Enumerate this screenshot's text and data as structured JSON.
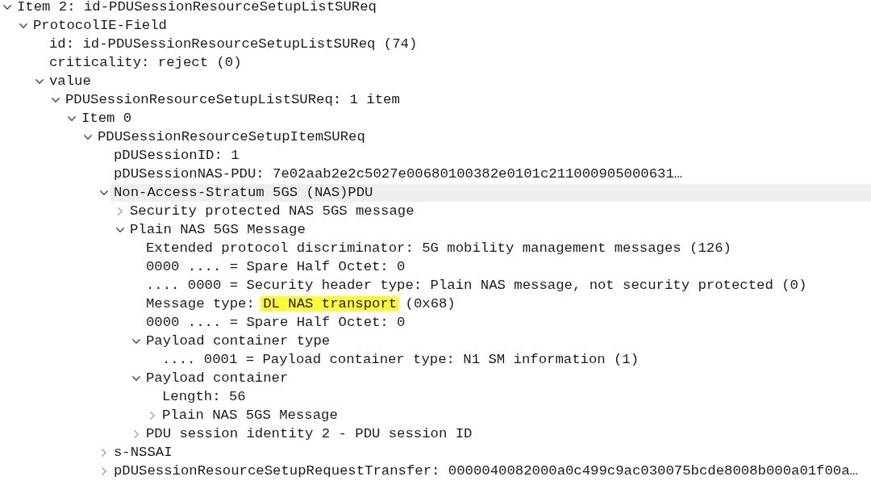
{
  "packet_details": {
    "nodes": [
      {
        "text": "Item 2: id-PDUSessionResourceSetupListSUReq",
        "expanded": true,
        "selected": false,
        "children": [
          {
            "text": "ProtocolIE-Field",
            "expanded": true,
            "selected": false,
            "children": [
              {
                "text": "id: id-PDUSessionResourceSetupListSUReq (74)",
                "selected": false
              },
              {
                "text": "criticality: reject (0)",
                "selected": false
              },
              {
                "text": "value",
                "expanded": true,
                "selected": false,
                "children": [
                  {
                    "text": "PDUSessionResourceSetupListSUReq: 1 item",
                    "expanded": true,
                    "selected": false,
                    "children": [
                      {
                        "text": "Item 0",
                        "expanded": true,
                        "selected": false,
                        "children": [
                          {
                            "text": "PDUSessionResourceSetupItemSUReq",
                            "expanded": true,
                            "selected": false,
                            "children": [
                              {
                                "text": "pDUSessionID: 1",
                                "selected": false
                              },
                              {
                                "text": "pDUSessionNAS-PDU: 7e02aab2e2c5027e00680100382e0101c211000905000631…",
                                "selected": false
                              },
                              {
                                "text": "Non-Access-Stratum 5GS (NAS)PDU",
                                "expanded": true,
                                "selected": true,
                                "children": [
                                  {
                                    "text": "Security protected NAS 5GS message",
                                    "expanded": false,
                                    "selected": false
                                  },
                                  {
                                    "text": "Plain NAS 5GS Message",
                                    "expanded": true,
                                    "selected": false,
                                    "children": [
                                      {
                                        "text": "Extended protocol discriminator: 5G mobility management messages (126)",
                                        "selected": false
                                      },
                                      {
                                        "text": "0000 .... = Spare Half Octet: 0",
                                        "selected": false
                                      },
                                      {
                                        "text": ".... 0000 = Security header type: Plain NAS message, not security protected (0)",
                                        "selected": false
                                      },
                                      {
                                        "parts": [
                                          {
                                            "text": "Message type:",
                                            "highlighted": false
                                          },
                                          {
                                            "text": "DL NAS transport",
                                            "highlighted": true
                                          },
                                          {
                                            "text": "(0x68)",
                                            "highlighted": false
                                          }
                                        ],
                                        "selected": false
                                      },
                                      {
                                        "text": "0000 .... = Spare Half Octet: 0",
                                        "selected": false
                                      },
                                      {
                                        "text": "Payload container type",
                                        "expanded": true,
                                        "selected": false,
                                        "children": [
                                          {
                                            "text": ".... 0001 = Payload container type: N1 SM information (1)",
                                            "selected": false
                                          }
                                        ]
                                      },
                                      {
                                        "text": "Payload container",
                                        "expanded": true,
                                        "selected": false,
                                        "children": [
                                          {
                                            "text": "Length: 56",
                                            "selected": false
                                          },
                                          {
                                            "text": "Plain NAS 5GS Message",
                                            "expanded": false,
                                            "selected": false
                                          }
                                        ]
                                      },
                                      {
                                        "text": "PDU session identity 2 - PDU session ID",
                                        "expanded": false,
                                        "selected": false
                                      }
                                    ]
                                  }
                                ]
                              },
                              {
                                "text": "s-NSSAI",
                                "expanded": false,
                                "selected": false
                              },
                              {
                                "text": "pDUSessionResourceSetupRequestTransfer: 0000040082000a0c499c9ac030075bcde8008b000a01f00a…",
                                "expanded": false,
                                "selected": false
                              }
                            ]
                          }
                        ]
                      }
                    ]
                  }
                ]
              }
            ]
          }
        ]
      }
    ]
  }
}
